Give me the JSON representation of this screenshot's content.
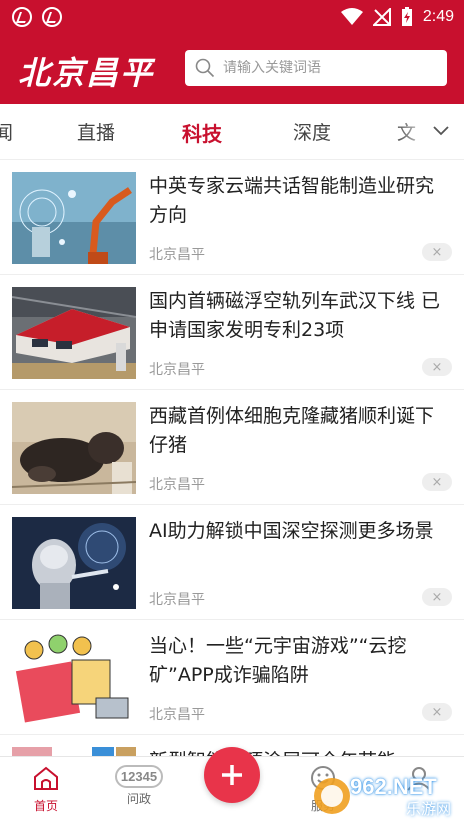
{
  "status_bar": {
    "time": "2:49"
  },
  "header": {
    "logo": "北京昌平",
    "search_placeholder": "请输入关键词语"
  },
  "tabs": [
    {
      "label": "闻",
      "active": false
    },
    {
      "label": "直播",
      "active": false
    },
    {
      "label": "科技",
      "active": true
    },
    {
      "label": "深度",
      "active": false
    },
    {
      "label": "文",
      "active": false
    }
  ],
  "news": [
    {
      "title": "中英专家云端共话智能制造业研究方向",
      "source": "北京昌平",
      "dismiss": "×"
    },
    {
      "title": "国内首辆磁浮空轨列车武汉下线 已申请国家发明专利23项",
      "source": "北京昌平",
      "dismiss": "×"
    },
    {
      "title": "西藏首例体细胞克隆藏猪顺利诞下仔猪",
      "source": "北京昌平",
      "dismiss": "×"
    },
    {
      "title": "AI助力解锁中国深空探测更多场景",
      "source": "北京昌平",
      "dismiss": "×"
    },
    {
      "title": "当心！一些“元宇宙游戏”“云挖矿”APP成诈骗陷阱",
      "source": "北京昌平",
      "dismiss": "×"
    },
    {
      "title": "新型智能屋顶涂层可全年节能",
      "source": "",
      "dismiss": ""
    }
  ],
  "bottom_nav": [
    {
      "label": "首页",
      "active": true
    },
    {
      "label": "问政",
      "active": false
    },
    {
      "label": "服务",
      "active": false
    }
  ],
  "nav_badge": "12345",
  "watermark": {
    "brand": "962.NET",
    "sub": "乐游网"
  },
  "colors": {
    "brand_red": "#c8102e",
    "center_button": "#e8344a"
  }
}
